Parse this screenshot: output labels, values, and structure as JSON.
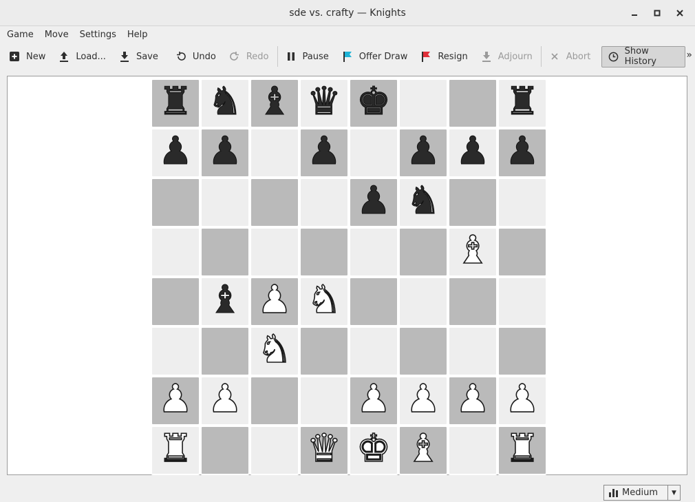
{
  "window": {
    "title": "sde vs. crafty — Knights",
    "minimize_glyph": "—",
    "maximize_glyph": "□",
    "close_glyph": "✕"
  },
  "menubar": {
    "items": [
      {
        "label": "Game"
      },
      {
        "label": "Move"
      },
      {
        "label": "Settings"
      },
      {
        "label": "Help"
      }
    ]
  },
  "toolbar": {
    "new": {
      "label": "New",
      "icon": "plus-square-icon"
    },
    "load": {
      "label": "Load...",
      "icon": "upload-icon"
    },
    "save": {
      "label": "Save",
      "icon": "download-icon"
    },
    "undo": {
      "label": "Undo",
      "icon": "undo-icon"
    },
    "redo": {
      "label": "Redo",
      "icon": "redo-icon",
      "enabled": false
    },
    "pause": {
      "label": "Pause",
      "icon": "pause-icon"
    },
    "offer_draw": {
      "label": "Offer Draw",
      "icon": "cyan-flag-icon"
    },
    "resign": {
      "label": "Resign",
      "icon": "red-flag-icon"
    },
    "adjourn": {
      "label": "Adjourn",
      "icon": "download-icon",
      "enabled": false
    },
    "abort": {
      "label": "Abort",
      "icon": "close-icon",
      "enabled": false
    },
    "show_history": {
      "label": "Show History",
      "icon": "clock-icon",
      "pressed": true
    },
    "overflow_glyph": "»"
  },
  "colors": {
    "light_square": "#eeeeee",
    "dark_square": "#bababa",
    "offer_draw_flag": "#1fb3d6",
    "resign_flag": "#e0303a"
  },
  "board": {
    "rows": [
      [
        "r",
        "n",
        "b",
        "q",
        "k",
        "",
        "",
        "r"
      ],
      [
        "p",
        "p",
        "",
        "p",
        "",
        "p",
        "p",
        "p"
      ],
      [
        "",
        "",
        "",
        "",
        "p",
        "n",
        "",
        ""
      ],
      [
        "",
        "",
        "",
        "",
        "",
        "",
        "B",
        ""
      ],
      [
        "",
        "b",
        "P",
        "N",
        "",
        "",
        "",
        ""
      ],
      [
        "",
        "",
        "N",
        "",
        "",
        "",
        "",
        ""
      ],
      [
        "P",
        "P",
        "",
        "",
        "P",
        "P",
        "P",
        "P"
      ],
      [
        "R",
        "",
        "",
        "Q",
        "K",
        "B",
        "",
        "R"
      ]
    ]
  },
  "status": {
    "difficulty": "Medium"
  }
}
